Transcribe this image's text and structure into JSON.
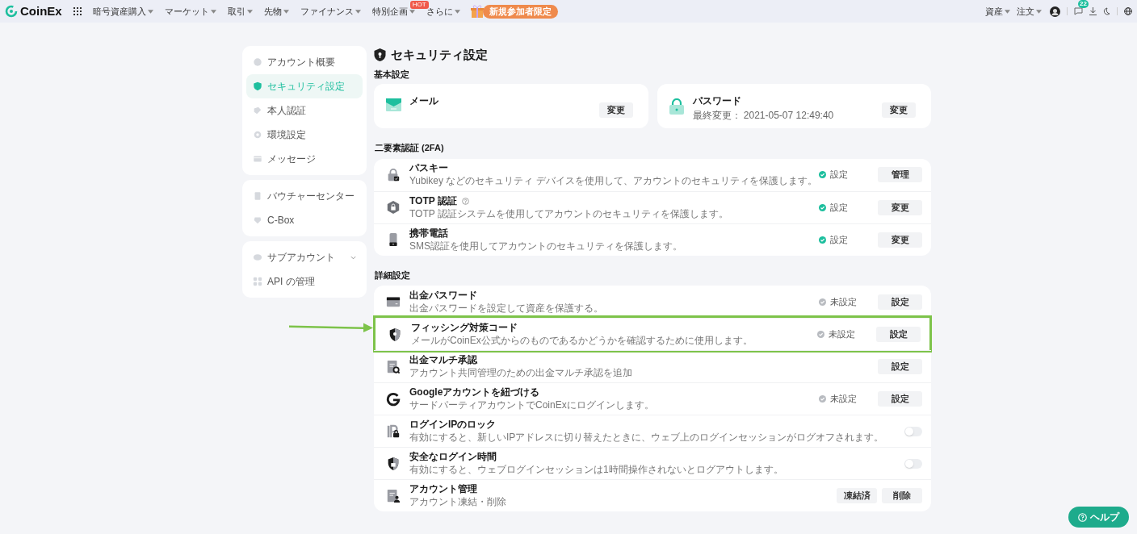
{
  "header": {
    "logo": "CoinEx",
    "nav": [
      {
        "label": "暗号資産購入",
        "dropdown": true
      },
      {
        "label": "マーケット",
        "dropdown": true
      },
      {
        "label": "取引",
        "dropdown": true
      },
      {
        "label": "先物",
        "dropdown": true
      },
      {
        "label": "ファイナンス",
        "dropdown": true
      },
      {
        "label": "特別企画",
        "dropdown": true,
        "badge": "HOT"
      },
      {
        "label": "さらに",
        "dropdown": true
      }
    ],
    "promo": "新規参加者限定",
    "right": [
      {
        "label": "資産",
        "dropdown": true
      },
      {
        "label": "注文",
        "dropdown": true
      }
    ],
    "message_count": "22"
  },
  "sidebar": {
    "groups": [
      {
        "items": [
          {
            "label": "アカウント概要",
            "selected": false
          },
          {
            "label": "セキュリティ設定",
            "selected": true
          },
          {
            "label": "本人認証",
            "selected": false
          },
          {
            "label": "環境設定",
            "selected": false
          },
          {
            "label": "メッセージ",
            "selected": false
          }
        ]
      },
      {
        "items": [
          {
            "label": "バウチャーセンター",
            "selected": false
          },
          {
            "label": "C-Box",
            "selected": false
          }
        ]
      },
      {
        "items": [
          {
            "label": "サブアカウント",
            "selected": false,
            "expandable": true
          },
          {
            "label": "API の管理",
            "selected": false
          }
        ]
      }
    ]
  },
  "page": {
    "title": "セキュリティ設定",
    "basic": {
      "heading": "基本設定",
      "cards": [
        {
          "title": "メール",
          "button": "変更"
        },
        {
          "title": "パスワード",
          "subtitle": "最終変更： 2021-05-07 12:49:40",
          "button": "変更"
        }
      ]
    },
    "sections": [
      {
        "heading": "二要素認証 (2FA)",
        "rows": [
          {
            "kind": "action",
            "title": "パスキー",
            "description": "Yubikey などのセキュリティ デバイスを使用して、アカウントのセキュリティを保護します。",
            "status": {
              "label": "設定",
              "set": true
            },
            "buttons": [
              "管理"
            ],
            "highlighted": false
          },
          {
            "kind": "action",
            "title": "TOTP 認証",
            "help": true,
            "description": "TOTP 認証システムを使用してアカウントのセキュリティを保護します。",
            "status": {
              "label": "設定",
              "set": true
            },
            "buttons": [
              "変更"
            ],
            "highlighted": false
          },
          {
            "kind": "action",
            "title": "携帯電話",
            "description": "SMS認証を使用してアカウントのセキュリティを保護します。",
            "status": {
              "label": "設定",
              "set": true
            },
            "buttons": [
              "変更"
            ],
            "highlighted": false
          }
        ]
      },
      {
        "heading": "詳細設定",
        "rows": [
          {
            "kind": "action",
            "title": "出金パスワード",
            "description": "出金パスワードを設定して資産を保護する。",
            "status": {
              "label": "未設定",
              "set": false
            },
            "buttons": [
              "設定"
            ],
            "highlighted": false
          },
          {
            "kind": "action",
            "title": "フィッシング対策コード",
            "description": "メールがCoinEx公式からのものであるかどうかを確認するために使用します。",
            "status": {
              "label": "未設定",
              "set": false
            },
            "buttons": [
              "設定"
            ],
            "highlighted": true
          },
          {
            "kind": "action",
            "title": "出金マルチ承認",
            "description": "アカウント共同管理のための出金マルチ承認を追加",
            "buttons": [
              "設定"
            ],
            "highlighted": false
          },
          {
            "kind": "action",
            "title": "Googleアカウントを紐づける",
            "description": "サードパーティアカウントでCoinExにログインします。",
            "status": {
              "label": "未設定",
              "set": false
            },
            "buttons": [
              "設定"
            ],
            "highlighted": false
          },
          {
            "kind": "toggle",
            "title": "ログインIPのロック",
            "description": "有効にすると、新しいIPアドレスに切り替えたときに、ウェブ上のログインセッションがログオフされます。",
            "on": false,
            "highlighted": false
          },
          {
            "kind": "toggle",
            "title": "安全なログイン時間",
            "description": "有効にすると、ウェブログインセッションは1時間操作されないとログアウトします。",
            "on": false,
            "highlighted": false
          },
          {
            "kind": "action",
            "title": "アカウント管理",
            "description": "アカウント凍結・削除",
            "buttons": [
              "凍結済",
              "削除"
            ],
            "highlighted": false
          }
        ]
      }
    ]
  },
  "help_button": "ヘルプ"
}
